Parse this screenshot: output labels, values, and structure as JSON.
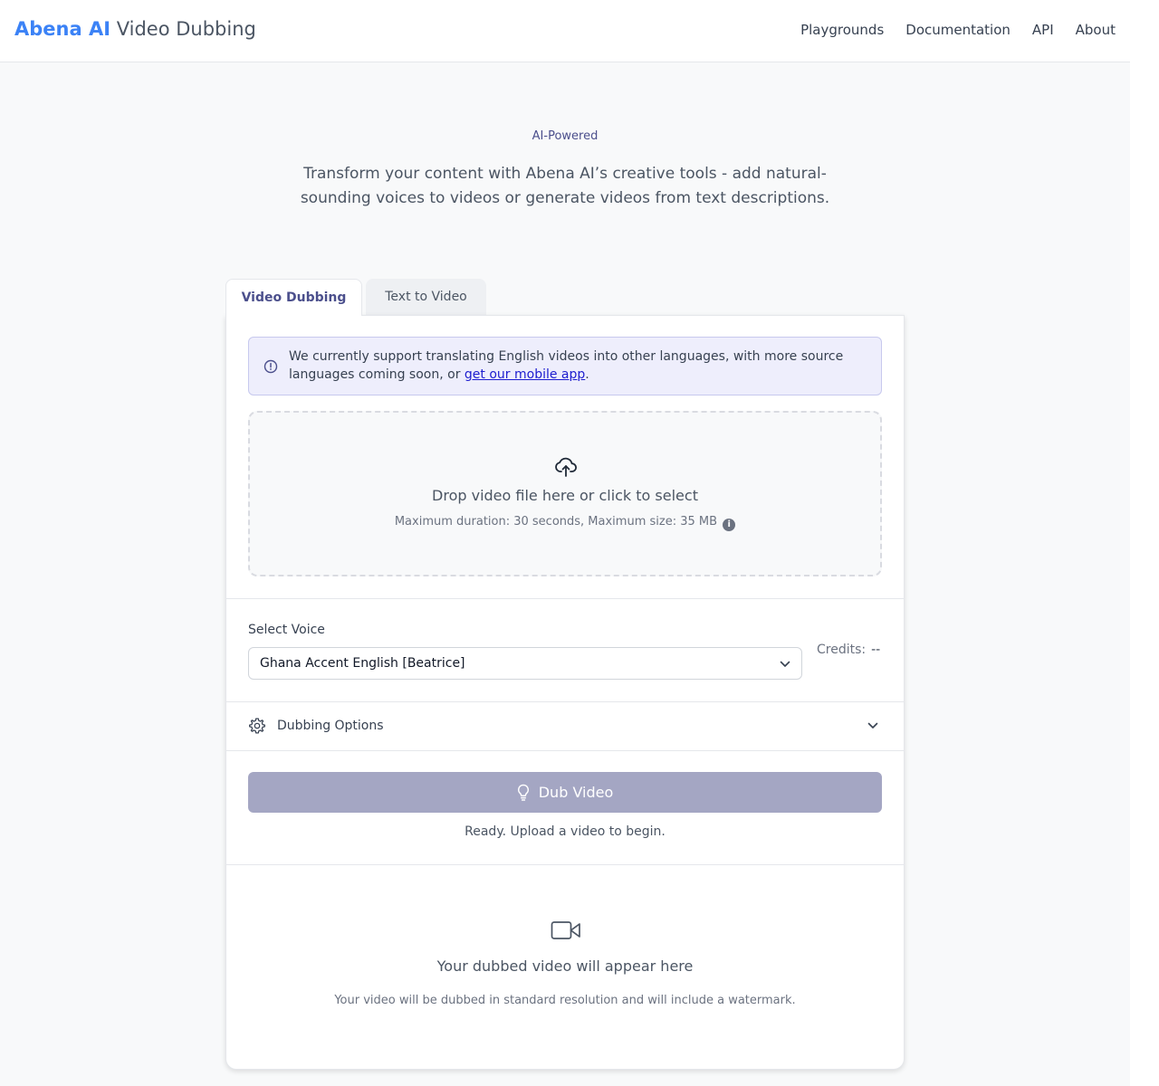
{
  "header": {
    "brand_accent": "Abena AI",
    "brand_rest": " Video Dubbing",
    "nav": [
      "Playgrounds",
      "Documentation",
      "API",
      "About"
    ]
  },
  "hero": {
    "badge": "AI-Powered",
    "text": "Transform your content with Abena AI’s creative tools - add natural-sounding voices to videos or generate videos from text descriptions."
  },
  "tabs": [
    {
      "label": "Video Dubbing",
      "active": true
    },
    {
      "label": "Text to Video",
      "active": false
    }
  ],
  "notice": {
    "text_before": "We currently support translating English videos into other languages, with more source languages coming soon, or ",
    "link": "get our mobile app",
    "text_after": "."
  },
  "upload": {
    "title": "Drop video file here or click to select",
    "subtitle": "Maximum duration: 30 seconds, Maximum size: 35 MB"
  },
  "voice": {
    "label": "Select Voice",
    "selected": "Ghana Accent English [Beatrice]",
    "credits_label": "Credits:",
    "credits_value": "--"
  },
  "options": {
    "label": "Dubbing Options"
  },
  "action": {
    "button": "Dub Video",
    "status": "Ready. Upload a video to begin."
  },
  "result": {
    "title": "Your dubbed video will appear here",
    "note": "Your video will be dubbed in standard resolution and will include a watermark."
  },
  "colors": {
    "brand": "#3b82f6",
    "accent": "#4b4f8c",
    "button_disabled": "#a4a6c3",
    "notice_bg": "#eeeefc"
  }
}
